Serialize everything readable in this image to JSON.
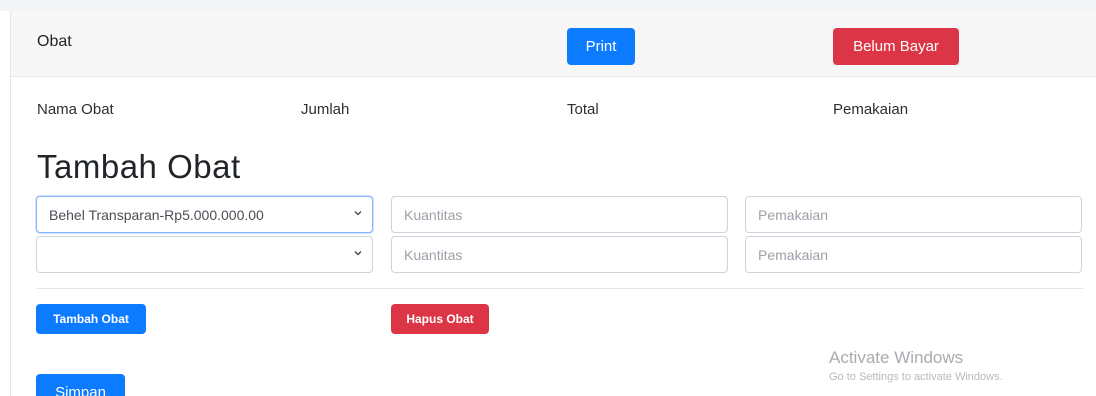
{
  "header": {
    "title": "Obat",
    "print_label": "Print",
    "status_label": "Belum Bayar"
  },
  "columns": {
    "nama": "Nama Obat",
    "jumlah": "Jumlah",
    "total": "Total",
    "pemakaian": "Pemakaian"
  },
  "form": {
    "heading": "Tambah Obat",
    "rows": [
      {
        "medicine_selected": "Behel Transparan-Rp5.000.000.00",
        "quantity_placeholder": "Kuantitas",
        "usage_placeholder": "Pemakaian"
      },
      {
        "medicine_selected": "",
        "quantity_placeholder": "Kuantitas",
        "usage_placeholder": "Pemakaian"
      }
    ],
    "add_button": "Tambah Obat",
    "remove_button": "Hapus Obat",
    "save_button": "Simpan"
  },
  "watermark": {
    "title": "Activate Windows",
    "subtitle": "Go to Settings to activate Windows."
  },
  "colors": {
    "primary": "#0d7bff",
    "danger": "#dc3545"
  }
}
